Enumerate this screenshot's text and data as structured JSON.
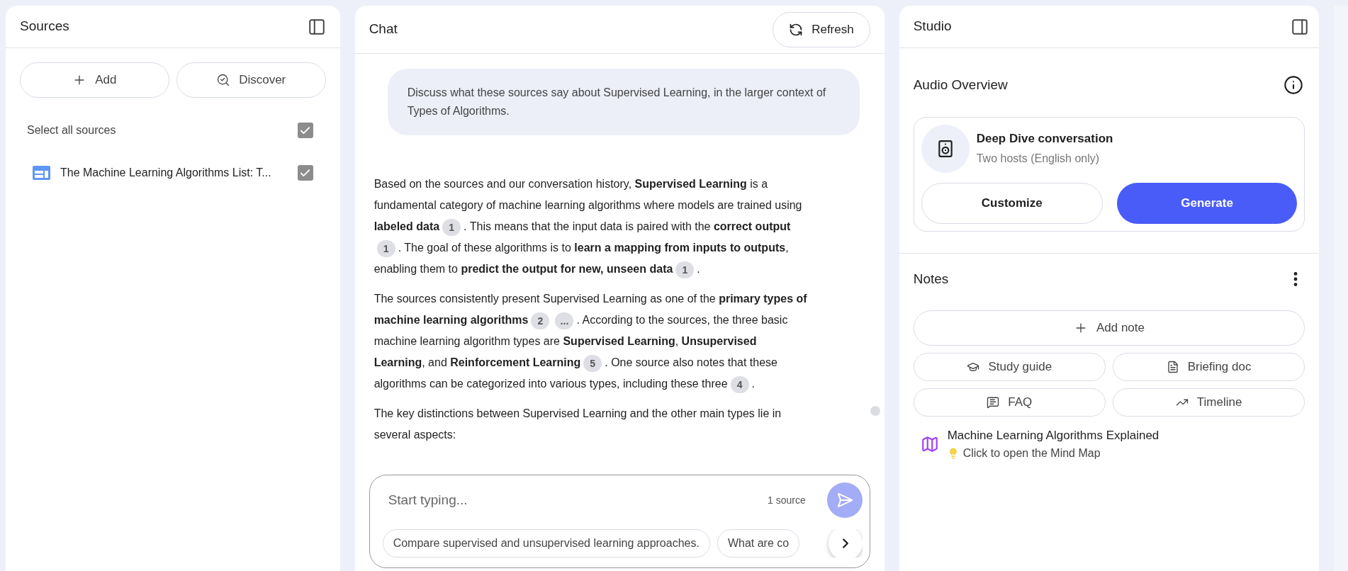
{
  "sources_panel": {
    "title": "Sources",
    "add_button": "Add",
    "discover_button": "Discover",
    "select_all": {
      "label": "Select all sources",
      "checked": true
    },
    "sources": [
      {
        "title": "The Machine Learning Algorithms List: T...",
        "checked": true
      }
    ]
  },
  "chat": {
    "title": "Chat",
    "refresh_button": "Refresh",
    "user_message": "Discuss what these sources say about Supervised Learning, in the larger context of Types of Algorithms.",
    "response": [
      [
        {
          "kind": "text",
          "text": "Based on the sources and our conversation history, **Supervised Learning** is a fundamental category of machine learning algorithms where models are trained using **labeled data**"
        },
        {
          "kind": "citation",
          "text": "1"
        },
        {
          "kind": "text",
          "text": ". This means that the input data is paired with the **correct output**"
        },
        {
          "kind": "citation",
          "text": "1"
        },
        {
          "kind": "text",
          "text": ". The goal of these algorithms is to **learn a mapping from inputs to outputs**, enabling them to **predict the output for new, unseen data**"
        },
        {
          "kind": "citation",
          "text": "1"
        },
        {
          "kind": "text",
          "text": "."
        }
      ],
      [
        {
          "kind": "text",
          "text": "The sources consistently present Supervised Learning as one of the **primary types of machine learning algorithms**"
        },
        {
          "kind": "citation",
          "text": "2"
        },
        {
          "kind": "citation",
          "text": "..."
        },
        {
          "kind": "text",
          "text": ". According to the sources, the three basic machine learning algorithm types are **Supervised Learning**, **Unsupervised Learning**, and **Reinforcement Learning**"
        },
        {
          "kind": "citation",
          "text": "5"
        },
        {
          "kind": "text",
          "text": ". One source also notes that these algorithms can be categorized into various types, including these three"
        },
        {
          "kind": "citation",
          "text": "4"
        },
        {
          "kind": "text",
          "text": "."
        }
      ],
      [
        {
          "kind": "text",
          "text": "The key distinctions between Supervised Learning and the other main types lie in several aspects:"
        }
      ]
    ],
    "input": {
      "placeholder": "Start typing...",
      "source_count": "1 source"
    },
    "suggestions": [
      "Compare supervised and unsupervised learning approaches.",
      "What are co"
    ]
  },
  "studio": {
    "title": "Studio",
    "audio_overview": {
      "title": "Audio Overview",
      "card_title": "Deep Dive conversation",
      "card_subtitle": "Two hosts (English only)",
      "customize_button": "Customize",
      "generate_button": "Generate"
    },
    "notes": {
      "title": "Notes",
      "add_note_button": "Add note",
      "actions": [
        {
          "kind": "study",
          "label": "Study guide"
        },
        {
          "kind": "briefing",
          "label": "Briefing doc"
        },
        {
          "kind": "faq",
          "label": "FAQ"
        },
        {
          "kind": "timeline",
          "label": "Timeline"
        }
      ],
      "items": [
        {
          "title": "Machine Learning Algorithms Explained",
          "subtitle": "Click to open the Mind Map"
        }
      ]
    }
  }
}
